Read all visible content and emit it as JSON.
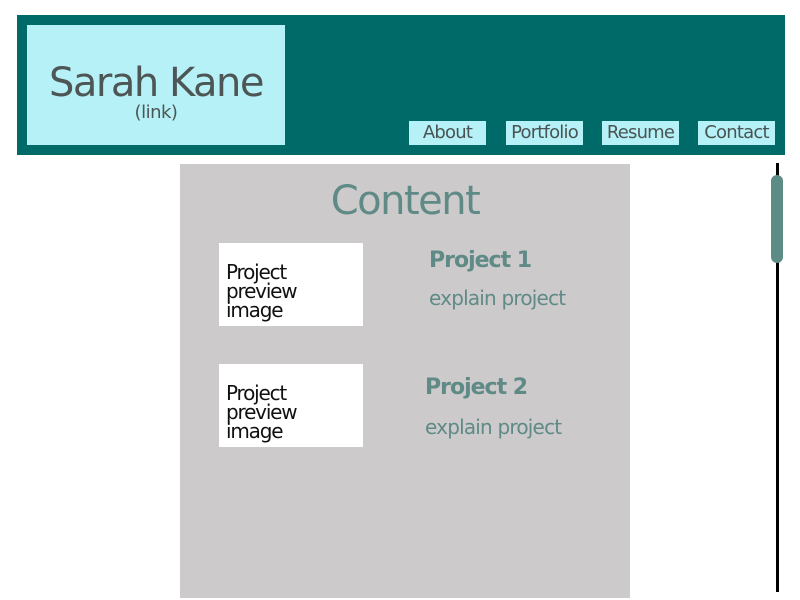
{
  "header": {
    "name": "Sarah Kane",
    "link_label": "(link)"
  },
  "nav": {
    "about": "About",
    "portfolio": "Portfolio",
    "resume": "Resume",
    "contact": "Contact"
  },
  "content": {
    "title": "Content",
    "projects": [
      {
        "preview_label": "Project preview image",
        "title": "Project 1",
        "description": "explain project"
      },
      {
        "preview_label": "Project preview image",
        "title": "Project 2",
        "description": "explain project"
      }
    ]
  },
  "colors": {
    "header_bg": "#006a69",
    "accent_light": "#b5f1f6",
    "content_bg": "#cccacb",
    "heading_text": "#5f8a86"
  }
}
